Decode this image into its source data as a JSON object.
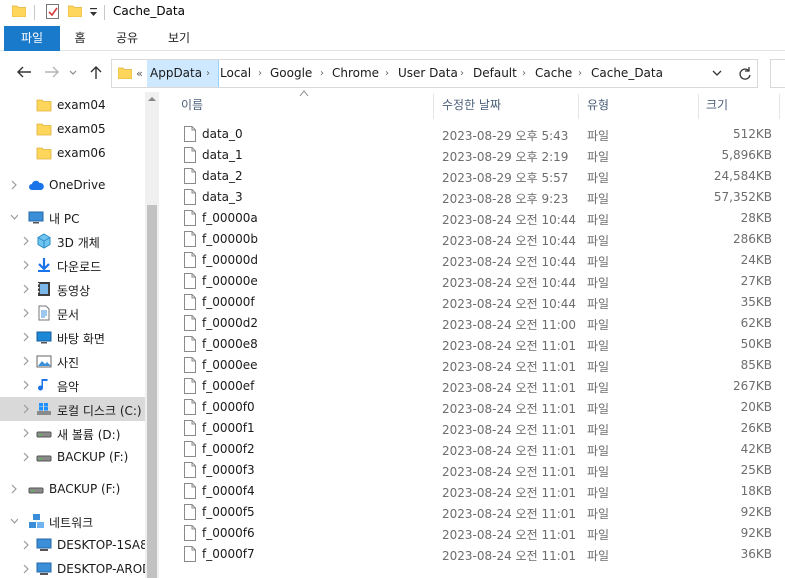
{
  "window": {
    "title": "Cache_Data"
  },
  "ribbon": {
    "tabs": [
      "파일",
      "홈",
      "공유",
      "보기"
    ]
  },
  "address": {
    "overflow": "«",
    "crumbs": [
      "AppData",
      "Local",
      "Google",
      "Chrome",
      "User Data",
      "Default",
      "Cache",
      "Cache_Data"
    ]
  },
  "sidebar": {
    "items": [
      {
        "label": "exam04",
        "icon": "folder-icon"
      },
      {
        "label": "exam05",
        "icon": "folder-icon"
      },
      {
        "label": "exam06",
        "icon": "folder-icon"
      },
      {
        "label": "OneDrive",
        "icon": "cloud-icon"
      },
      {
        "label": "내 PC",
        "icon": "pc-icon"
      },
      {
        "label": "3D 개체",
        "icon": "3d-objects-icon"
      },
      {
        "label": "다운로드",
        "icon": "download-icon"
      },
      {
        "label": "동영상",
        "icon": "video-icon"
      },
      {
        "label": "문서",
        "icon": "document-icon"
      },
      {
        "label": "바탕 화면",
        "icon": "desktop-icon"
      },
      {
        "label": "사진",
        "icon": "pictures-icon"
      },
      {
        "label": "음악",
        "icon": "music-icon"
      },
      {
        "label": "로컬 디스크 (C:)",
        "icon": "windows-drive-icon"
      },
      {
        "label": "새 볼륨 (D:)",
        "icon": "drive-icon"
      },
      {
        "label": "BACKUP (F:)",
        "icon": "drive-icon"
      },
      {
        "label": "BACKUP (F:)",
        "icon": "drive-icon"
      },
      {
        "label": "네트워크",
        "icon": "network-icon"
      },
      {
        "label": "DESKTOP-1SA8",
        "icon": "computer-icon"
      },
      {
        "label": "DESKTOP-AROD",
        "icon": "computer-icon"
      }
    ]
  },
  "columns": {
    "name": "이름",
    "date": "수정한 날짜",
    "type": "유형",
    "size": "크기"
  },
  "files": [
    {
      "name": "data_0",
      "date": "2023-08-29 오후 5:43",
      "type": "파일",
      "size": "512KB"
    },
    {
      "name": "data_1",
      "date": "2023-08-29 오후 2:19",
      "type": "파일",
      "size": "5,896KB"
    },
    {
      "name": "data_2",
      "date": "2023-08-29 오후 5:57",
      "type": "파일",
      "size": "24,584KB"
    },
    {
      "name": "data_3",
      "date": "2023-08-28 오후 9:23",
      "type": "파일",
      "size": "57,352KB"
    },
    {
      "name": "f_00000a",
      "date": "2023-08-24 오전 10:44",
      "type": "파일",
      "size": "28KB"
    },
    {
      "name": "f_00000b",
      "date": "2023-08-24 오전 10:44",
      "type": "파일",
      "size": "286KB"
    },
    {
      "name": "f_00000d",
      "date": "2023-08-24 오전 10:44",
      "type": "파일",
      "size": "24KB"
    },
    {
      "name": "f_00000e",
      "date": "2023-08-24 오전 10:44",
      "type": "파일",
      "size": "27KB"
    },
    {
      "name": "f_00000f",
      "date": "2023-08-24 오전 10:44",
      "type": "파일",
      "size": "35KB"
    },
    {
      "name": "f_0000d2",
      "date": "2023-08-24 오전 11:00",
      "type": "파일",
      "size": "62KB"
    },
    {
      "name": "f_0000e8",
      "date": "2023-08-24 오전 11:01",
      "type": "파일",
      "size": "50KB"
    },
    {
      "name": "f_0000ee",
      "date": "2023-08-24 오전 11:01",
      "type": "파일",
      "size": "85KB"
    },
    {
      "name": "f_0000ef",
      "date": "2023-08-24 오전 11:01",
      "type": "파일",
      "size": "267KB"
    },
    {
      "name": "f_0000f0",
      "date": "2023-08-24 오전 11:01",
      "type": "파일",
      "size": "20KB"
    },
    {
      "name": "f_0000f1",
      "date": "2023-08-24 오전 11:01",
      "type": "파일",
      "size": "26KB"
    },
    {
      "name": "f_0000f2",
      "date": "2023-08-24 오전 11:01",
      "type": "파일",
      "size": "42KB"
    },
    {
      "name": "f_0000f3",
      "date": "2023-08-24 오전 11:01",
      "type": "파일",
      "size": "25KB"
    },
    {
      "name": "f_0000f4",
      "date": "2023-08-24 오전 11:01",
      "type": "파일",
      "size": "18KB"
    },
    {
      "name": "f_0000f5",
      "date": "2023-08-24 오전 11:01",
      "type": "파일",
      "size": "92KB"
    },
    {
      "name": "f_0000f6",
      "date": "2023-08-24 오전 11:01",
      "type": "파일",
      "size": "92KB"
    },
    {
      "name": "f_0000f7",
      "date": "2023-08-24 오전 11:01",
      "type": "파일",
      "size": "36KB"
    }
  ],
  "colors": {
    "accent": "#1979ca",
    "folder": "#ffd65c",
    "selected_crumb": "#cde8ff",
    "sidebar_selected": "#d9d9d9"
  }
}
